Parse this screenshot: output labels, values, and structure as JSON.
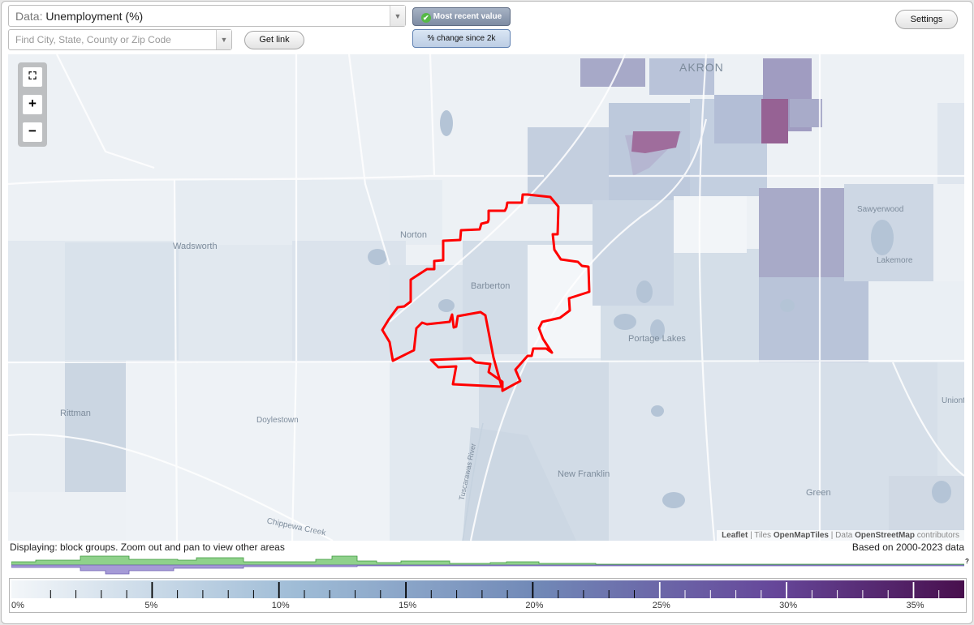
{
  "controls": {
    "data_prefix": "Data:",
    "data_value": "Unemployment (%)",
    "search_placeholder": "Find City, State, County or Zip Code",
    "get_link_label": "Get link",
    "settings_label": "Settings",
    "mode_recent_label": "Most recent value",
    "mode_change_label": "% change since 2k",
    "dropdown_icon": "triangle-down",
    "check_icon": "checkmark"
  },
  "map": {
    "zoom_controls": {
      "fit": "fit-extent-icon",
      "plus": "+",
      "minus": "−"
    },
    "place_labels": [
      "AKRON",
      "Norton",
      "Wadsworth",
      "Barberton",
      "Sawyerwood",
      "Lakemore",
      "Portage Lakes",
      "Rittman",
      "Doylestown",
      "New Franklin",
      "Green",
      "Uniont",
      "Chippewa Creek",
      "Tuscarawas River"
    ],
    "attribution": {
      "leaflet": "Leaflet",
      "tiles_label": "Tiles",
      "tiles": "OpenMapTiles",
      "data_label": "Data",
      "data": "OpenStreetMap",
      "contributors": "contributors"
    },
    "outline_color": "#ff0000"
  },
  "status": {
    "displaying": "Displaying: block groups. Zoom out and pan to view other areas",
    "based_on": "Based on 2000-2023 data",
    "unknown_mark": "?"
  },
  "legend": {
    "min": 0,
    "max": 37,
    "labels": [
      "0%",
      "5%",
      "10%",
      "15%",
      "20%",
      "25%",
      "30%",
      "35%"
    ],
    "colors": [
      "#f3f6f9",
      "#9fbcd6",
      "#7189b7",
      "#66479a",
      "#480f4d"
    ],
    "histogram_colors": {
      "upper": "#8fd18b",
      "lower": "#a59ad6"
    }
  }
}
